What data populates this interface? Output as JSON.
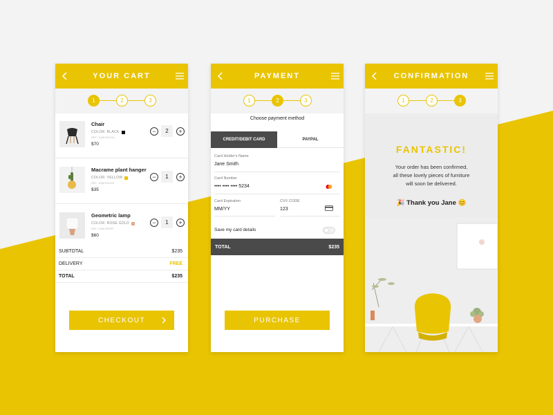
{
  "brand": {
    "accent": "#e9c403",
    "dark": "#4a4a4a"
  },
  "cart": {
    "title": "YOUR CART",
    "back_icon": "chevron-left-icon",
    "menu_icon": "hamburger-menu-icon",
    "steps": [
      "1",
      "2",
      "3"
    ],
    "active_step": 1,
    "items": [
      {
        "name": "Chair",
        "color_label": "COLOR: BLACK",
        "swatch": "#111111",
        "ref": "REF: 3456789JHU",
        "price": "$70",
        "qty": "2",
        "minus": "−",
        "plus": "+"
      },
      {
        "name": "Macrame plant hanger",
        "color_label": "COLOR: YELLOW",
        "swatch": "#e9c403",
        "ref": "REF: 3456789JUS",
        "price": "$35",
        "qty": "1",
        "minus": "−",
        "plus": "+"
      },
      {
        "name": "Geometric lamp",
        "color_label": "COLOR: ROSE GOLD",
        "swatch": "#e2a98d",
        "ref": "REF: 2456789HPI",
        "price": "$60",
        "qty": "1",
        "minus": "−",
        "plus": "+"
      }
    ],
    "summary": [
      {
        "label": "SUBTOTAL",
        "value": "$235"
      },
      {
        "label": "DELIVERY",
        "value": "FREE"
      },
      {
        "label": "TOTAL",
        "value": "$235"
      }
    ],
    "checkout_label": "CHECKOUT"
  },
  "payment": {
    "title": "PAYMENT",
    "steps": [
      "1",
      "2",
      "3"
    ],
    "active_step": 2,
    "heading": "Choose payment method",
    "tabs": [
      "CREDIT/DEBIT CARD",
      "PAYPAL"
    ],
    "fields": {
      "holder_label": "Card Holder's Name",
      "holder_value": "Jane Smith",
      "number_label": "Card Number",
      "number_value": "•••• •••• •••• 5234",
      "expiration_label": "Card Expiration",
      "expiration_value": "MM/YY",
      "cvv_label": "CVV CODE",
      "cvv_value": "123"
    },
    "save_label": "Save my card details",
    "total_label": "TOTAL",
    "total_value": "$235",
    "purchase_label": "PURCHASE"
  },
  "confirmation": {
    "title": "CONFIRMATION",
    "steps": [
      "1",
      "2",
      "3"
    ],
    "active_step": 3,
    "headline": "FANTASTIC!",
    "message_lines": [
      "Your order has been confirmed,",
      "all these lovely pieces of furniture",
      "will soon be delivered."
    ],
    "thanks": "🎉 Thank you Jane 😊"
  }
}
